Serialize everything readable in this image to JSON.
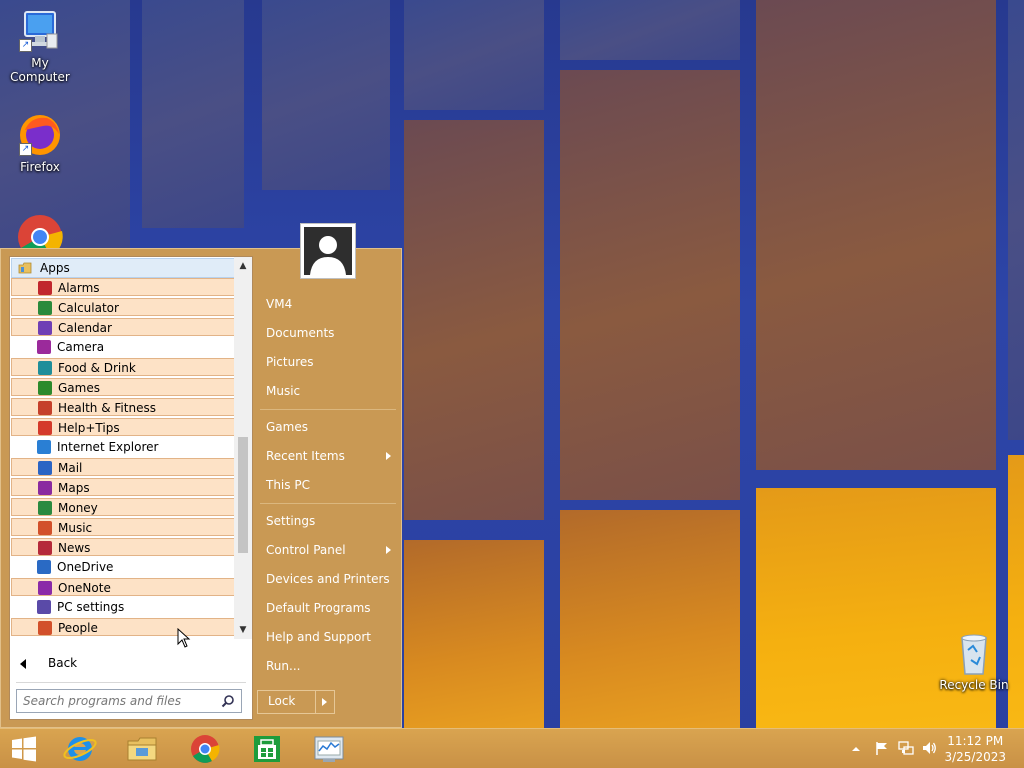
{
  "desktop": {
    "icons": [
      {
        "label": "My Computer"
      },
      {
        "label": "Firefox"
      },
      {
        "label": "Recycle Bin"
      }
    ]
  },
  "start_menu": {
    "apps_header": "Apps",
    "apps": [
      {
        "label": "Alarms",
        "highlight": true,
        "color": "#c1272d"
      },
      {
        "label": "Calculator",
        "highlight": true,
        "color": "#2a8a3c"
      },
      {
        "label": "Calendar",
        "highlight": true,
        "color": "#6f3fb5"
      },
      {
        "label": "Camera",
        "highlight": false,
        "color": "#9b2a9b"
      },
      {
        "label": "Food & Drink",
        "highlight": true,
        "color": "#1f8e9a"
      },
      {
        "label": "Games",
        "highlight": true,
        "color": "#2c8a2c"
      },
      {
        "label": "Health & Fitness",
        "highlight": true,
        "color": "#c5402a"
      },
      {
        "label": "Help+Tips",
        "highlight": true,
        "color": "#d43a2a"
      },
      {
        "label": "Internet Explorer",
        "highlight": false,
        "color": "#2a7fd4"
      },
      {
        "label": "Mail",
        "highlight": true,
        "color": "#2a64c4"
      },
      {
        "label": "Maps",
        "highlight": true,
        "color": "#8a2aa0"
      },
      {
        "label": "Money",
        "highlight": true,
        "color": "#2a8a40"
      },
      {
        "label": "Music",
        "highlight": true,
        "color": "#d2502a"
      },
      {
        "label": "News",
        "highlight": true,
        "color": "#b52a3a"
      },
      {
        "label": "OneDrive",
        "highlight": false,
        "color": "#2a6ac4"
      },
      {
        "label": "OneNote",
        "highlight": true,
        "color": "#8a2aa8"
      },
      {
        "label": "PC settings",
        "highlight": false,
        "color": "#5a4aa8"
      },
      {
        "label": "People",
        "highlight": true,
        "color": "#d2502a"
      }
    ],
    "back_label": "Back",
    "search_placeholder": "Search programs and files",
    "right_items": [
      {
        "label": "VM4"
      },
      {
        "label": "Documents"
      },
      {
        "label": "Pictures"
      },
      {
        "label": "Music"
      },
      {
        "label": "Games"
      },
      {
        "label": "Recent Items",
        "submenu": true
      },
      {
        "label": "This PC"
      },
      {
        "label": "Settings"
      },
      {
        "label": "Control Panel",
        "submenu": true
      },
      {
        "label": "Devices and Printers"
      },
      {
        "label": "Default Programs"
      },
      {
        "label": "Help and Support"
      },
      {
        "label": "Run..."
      }
    ],
    "lock_label": "Lock"
  },
  "taskbar": {
    "clock_time": "11:12 PM",
    "clock_date": "3/25/2023"
  },
  "colors": {
    "menu_bg": "#c99954",
    "highlight_bg": "#fde2c6",
    "taskbar_bg": "#d9a450"
  }
}
